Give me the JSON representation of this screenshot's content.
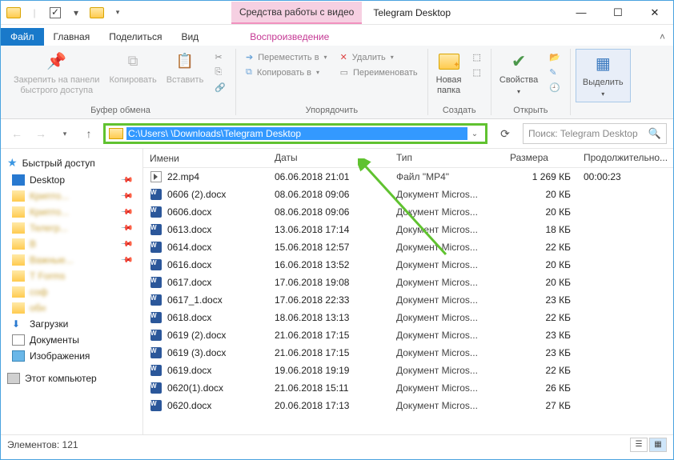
{
  "window": {
    "video_tools_label": "Средства работы с видео",
    "title": "Telegram Desktop"
  },
  "tabs": {
    "file": "Файл",
    "home": "Главная",
    "share": "Поделиться",
    "view": "Вид",
    "playback": "Воспроизведение"
  },
  "ribbon": {
    "pin": "Закрепить на панели\nбыстрого доступа",
    "copy": "Копировать",
    "paste": "Вставить",
    "clipboard_label": "Буфер обмена",
    "move_to": "Переместить в",
    "copy_to": "Копировать в",
    "delete": "Удалить",
    "rename": "Переименовать",
    "organize_label": "Упорядочить",
    "new_folder": "Новая\nпапка",
    "create_label": "Создать",
    "properties": "Свойства",
    "open_label": "Открыть",
    "select": "Выделить"
  },
  "nav": {
    "address": "C:\\Users\\            \\Downloads\\Telegram Desktop",
    "search_placeholder": "Поиск: Telegram Desktop"
  },
  "sidebar": {
    "quick_access": "Быстрый доступ",
    "desktop": "Desktop",
    "downloads": "Загрузки",
    "documents": "Документы",
    "pictures": "Изображения",
    "this_pc": "Этот компьютер"
  },
  "columns": {
    "name": "Имени",
    "date": "Даты",
    "type": "Тип",
    "size": "Размера",
    "duration": "Продолжительно..."
  },
  "files": [
    {
      "icon": "video",
      "name": "22.mp4",
      "date": "06.06.2018 21:01",
      "type": "Файл \"MP4\"",
      "size": "1 269 КБ",
      "duration": "00:00:23"
    },
    {
      "icon": "docx",
      "name": "0606 (2).docx",
      "date": "08.06.2018 09:06",
      "type": "Документ Micros...",
      "size": "20 КБ",
      "duration": ""
    },
    {
      "icon": "docx",
      "name": "0606.docx",
      "date": "08.06.2018 09:06",
      "type": "Документ Micros...",
      "size": "20 КБ",
      "duration": ""
    },
    {
      "icon": "docx",
      "name": "0613.docx",
      "date": "13.06.2018 17:14",
      "type": "Документ Micros...",
      "size": "18 КБ",
      "duration": ""
    },
    {
      "icon": "docx",
      "name": "0614.docx",
      "date": "15.06.2018 12:57",
      "type": "Документ Micros...",
      "size": "22 КБ",
      "duration": ""
    },
    {
      "icon": "docx",
      "name": "0616.docx",
      "date": "16.06.2018 13:52",
      "type": "Документ Micros...",
      "size": "20 КБ",
      "duration": ""
    },
    {
      "icon": "docx",
      "name": "0617.docx",
      "date": "17.06.2018 19:08",
      "type": "Документ Micros...",
      "size": "20 КБ",
      "duration": ""
    },
    {
      "icon": "docx",
      "name": "0617_1.docx",
      "date": "17.06.2018 22:33",
      "type": "Документ Micros...",
      "size": "23 КБ",
      "duration": ""
    },
    {
      "icon": "docx",
      "name": "0618.docx",
      "date": "18.06.2018 13:13",
      "type": "Документ Micros...",
      "size": "22 КБ",
      "duration": ""
    },
    {
      "icon": "docx",
      "name": "0619 (2).docx",
      "date": "21.06.2018 17:15",
      "type": "Документ Micros...",
      "size": "23 КБ",
      "duration": ""
    },
    {
      "icon": "docx",
      "name": "0619 (3).docx",
      "date": "21.06.2018 17:15",
      "type": "Документ Micros...",
      "size": "23 КБ",
      "duration": ""
    },
    {
      "icon": "docx",
      "name": "0619.docx",
      "date": "19.06.2018 19:19",
      "type": "Документ Micros...",
      "size": "22 КБ",
      "duration": ""
    },
    {
      "icon": "docx",
      "name": "0620(1).docx",
      "date": "21.06.2018 15:11",
      "type": "Документ Micros...",
      "size": "26 КБ",
      "duration": ""
    },
    {
      "icon": "docx",
      "name": "0620.docx",
      "date": "20.06.2018 17:13",
      "type": "Документ Micros...",
      "size": "27 КБ",
      "duration": ""
    }
  ],
  "status": {
    "count_label": "Элементов: 121"
  }
}
